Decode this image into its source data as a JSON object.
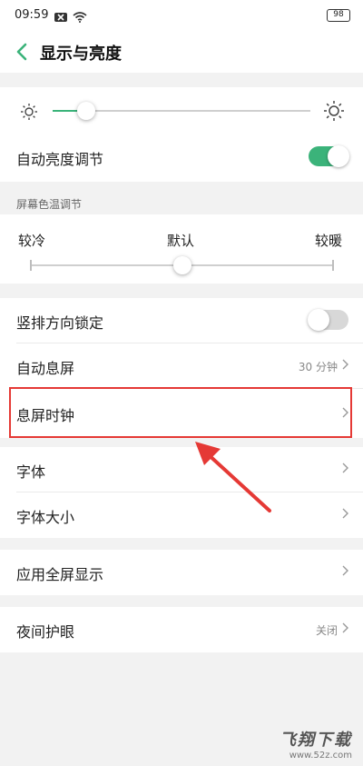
{
  "status_bar": {
    "time": "09:59",
    "battery": "98"
  },
  "header": {
    "title": "显示与亮度"
  },
  "brightness": {
    "level": 0.13
  },
  "auto_brightness": {
    "label": "自动亮度调节",
    "enabled": true
  },
  "color_temp": {
    "section_label": "屏幕色温调节",
    "cold_label": "较冷",
    "default_label": "默认",
    "warm_label": "较暖",
    "level": 0.5
  },
  "rows": {
    "orientation_lock": {
      "label": "竖排方向锁定",
      "enabled": false
    },
    "auto_screen_off": {
      "label": "自动息屏",
      "value": "30 分钟"
    },
    "screen_off_clock": {
      "label": "息屏时钟"
    },
    "font": {
      "label": "字体"
    },
    "font_size": {
      "label": "字体大小"
    },
    "fullscreen_apps": {
      "label": "应用全屏显示"
    },
    "night_eye": {
      "label": "夜间护眼",
      "value": "关闭"
    }
  },
  "watermark": {
    "main": "飞翔下载",
    "sub": "www.52z.com"
  },
  "colors": {
    "accent": "#3bb37a",
    "highlight": "#e53935"
  }
}
